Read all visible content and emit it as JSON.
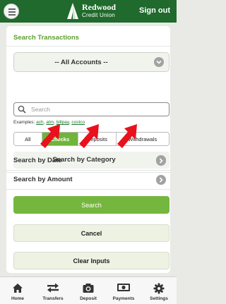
{
  "header": {
    "brand_line1": "Redwood",
    "brand_line2": "Credit Union",
    "signout_label": "Sign out"
  },
  "panel": {
    "title": "Search Transactions",
    "accounts_select": "-- All Accounts --",
    "search_placeholder": "Search",
    "examples_prefix": "Examples:",
    "examples": [
      "ach",
      "atm",
      "billpay",
      "costco"
    ],
    "filters": [
      {
        "label": "All",
        "active": false
      },
      {
        "label": "Checks",
        "active": true
      },
      {
        "label": "Deposits",
        "active": false
      },
      {
        "label": "Withdrawals",
        "active": false
      }
    ],
    "category_label": "Search by Category",
    "date_label": "Search by Date",
    "amount_label": "Search by Amount",
    "search_button": "Search",
    "cancel_button": "Cancel",
    "clear_button": "Clear Inputs"
  },
  "nav": [
    {
      "label": "Home",
      "icon": "home-icon"
    },
    {
      "label": "Transfers",
      "icon": "transfer-arrows-icon"
    },
    {
      "label": "Deposit",
      "icon": "camera-icon"
    },
    {
      "label": "Payments",
      "icon": "dollar-bill-icon"
    },
    {
      "label": "Settings",
      "icon": "gear-icon"
    }
  ],
  "colors": {
    "header": "#1f6a2c",
    "accent_green": "#75b73e",
    "annotation_arrow": "#e8111c"
  }
}
